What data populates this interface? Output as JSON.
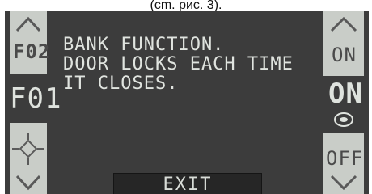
{
  "caption": "(cm. pис. 3).",
  "screen": {
    "message": "BANK FUNCTION.\nDOOR LOCKS EACH TIME\nIT CLOSES."
  },
  "left_panel": {
    "next_code": "F02",
    "current_code": "F01"
  },
  "right_panel": {
    "option_on_button": "ON",
    "current_value": "ON",
    "option_off_button": "OFF"
  },
  "bottom_bar": {
    "exit_label": "EXIT"
  }
}
